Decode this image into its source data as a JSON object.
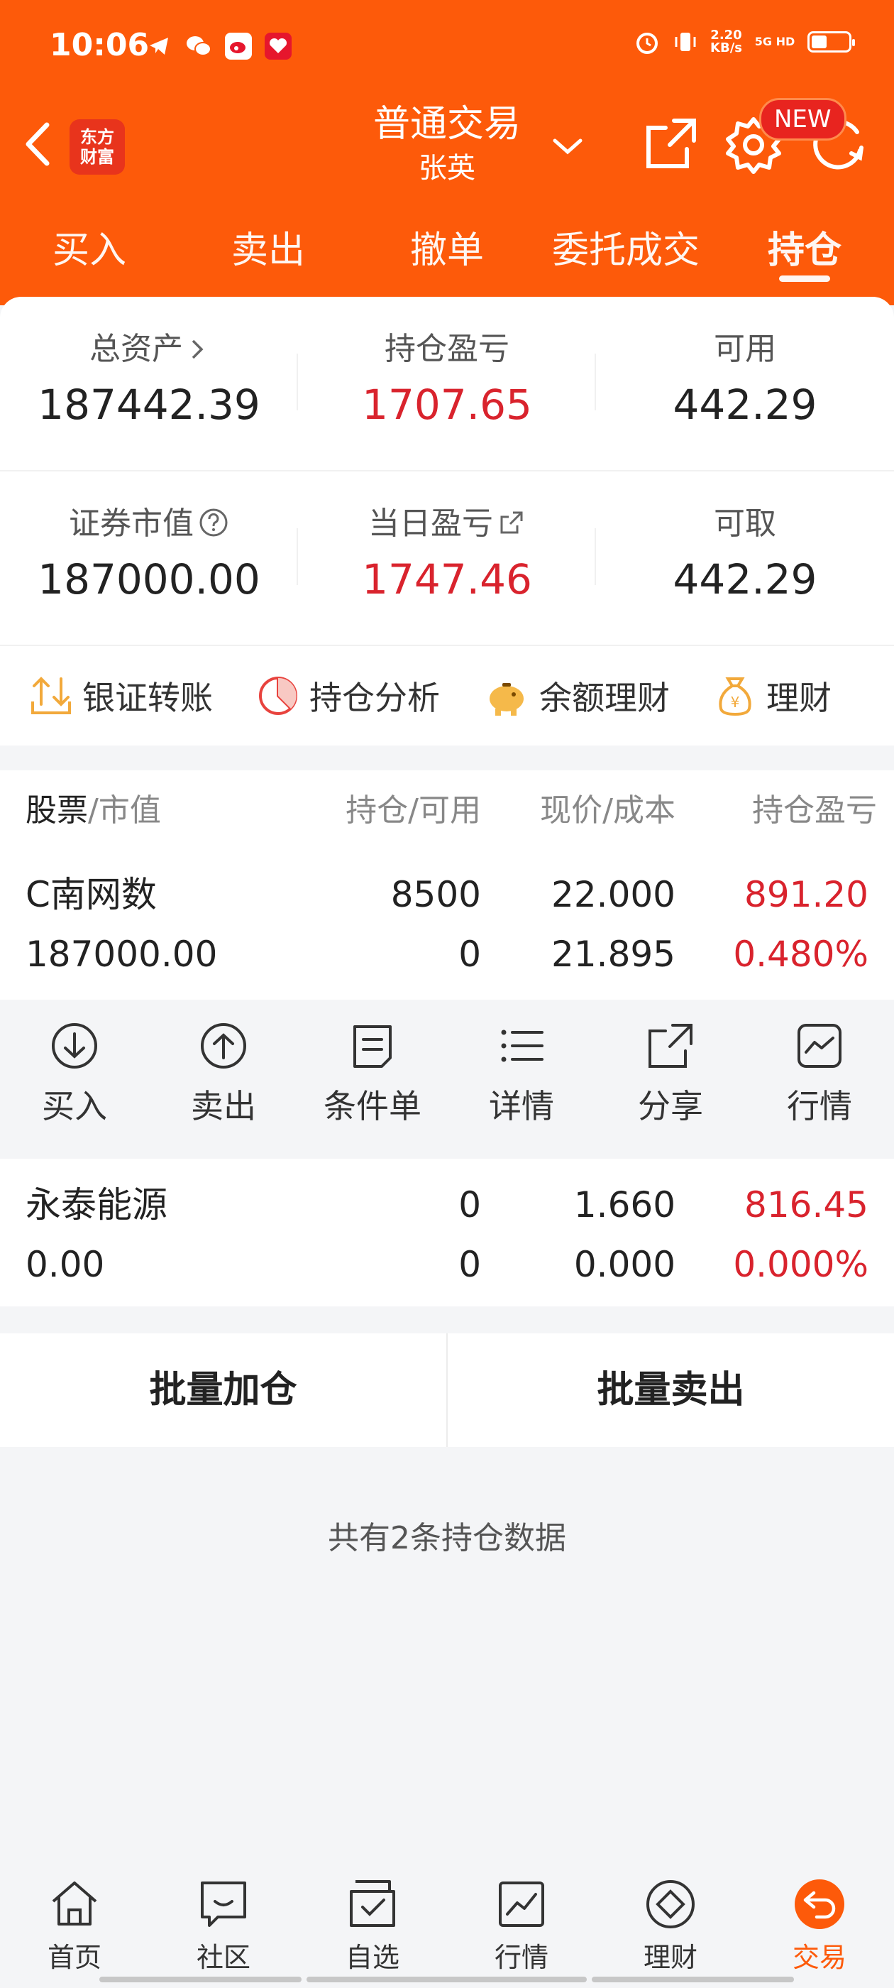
{
  "status": {
    "time": "10:06",
    "net_speed": "2.20",
    "net_unit": "KB/s",
    "signal": "5G HD"
  },
  "header": {
    "logo_line1": "东方",
    "logo_line2": "财富",
    "title": "普通交易",
    "subtitle": "张英",
    "new_badge": "NEW"
  },
  "tabs": [
    {
      "label": "买入"
    },
    {
      "label": "卖出"
    },
    {
      "label": "撤单"
    },
    {
      "label": "委托成交"
    },
    {
      "label": "持仓",
      "active": true
    }
  ],
  "summary": {
    "total_assets_label": "总资产",
    "total_assets": "187442.39",
    "position_pl_label": "持仓盈亏",
    "position_pl": "1707.65",
    "available_label": "可用",
    "available": "442.29",
    "market_value_label": "证券市值",
    "market_value": "187000.00",
    "daily_pl_label": "当日盈亏",
    "daily_pl": "1747.46",
    "withdrawable_label": "可取",
    "withdrawable": "442.29"
  },
  "quick_actions": [
    {
      "label": "银证转账"
    },
    {
      "label": "持仓分析"
    },
    {
      "label": "余额理财"
    },
    {
      "label": "理财"
    }
  ],
  "table": {
    "headers": {
      "stock": "股票",
      "stock_sub": "/市值",
      "position": "持仓/可用",
      "price": "现价/成本",
      "pl": "持仓盈亏"
    },
    "rows": [
      {
        "name": "C南网数",
        "market_value": "187000.00",
        "position": "8500",
        "available": "0",
        "price": "22.000",
        "cost": "21.895",
        "pl": "891.20",
        "pl_pct": "0.480%"
      },
      {
        "name": "永泰能源",
        "market_value": "0.00",
        "position": "0",
        "available": "0",
        "price": "1.660",
        "cost": "0.000",
        "pl": "816.45",
        "pl_pct": "0.000%"
      }
    ]
  },
  "row_actions": [
    {
      "label": "买入"
    },
    {
      "label": "卖出"
    },
    {
      "label": "条件单"
    },
    {
      "label": "详情"
    },
    {
      "label": "分享"
    },
    {
      "label": "行情"
    }
  ],
  "bulk": {
    "add": "批量加仓",
    "sell": "批量卖出"
  },
  "footer_text": "共有2条持仓数据",
  "bottom_nav": [
    {
      "label": "首页"
    },
    {
      "label": "社区"
    },
    {
      "label": "自选"
    },
    {
      "label": "行情"
    },
    {
      "label": "理财"
    },
    {
      "label": "交易",
      "active": true
    }
  ],
  "colors": {
    "brand": "#fd5a0a",
    "loss_gain_red": "#d9232d"
  }
}
